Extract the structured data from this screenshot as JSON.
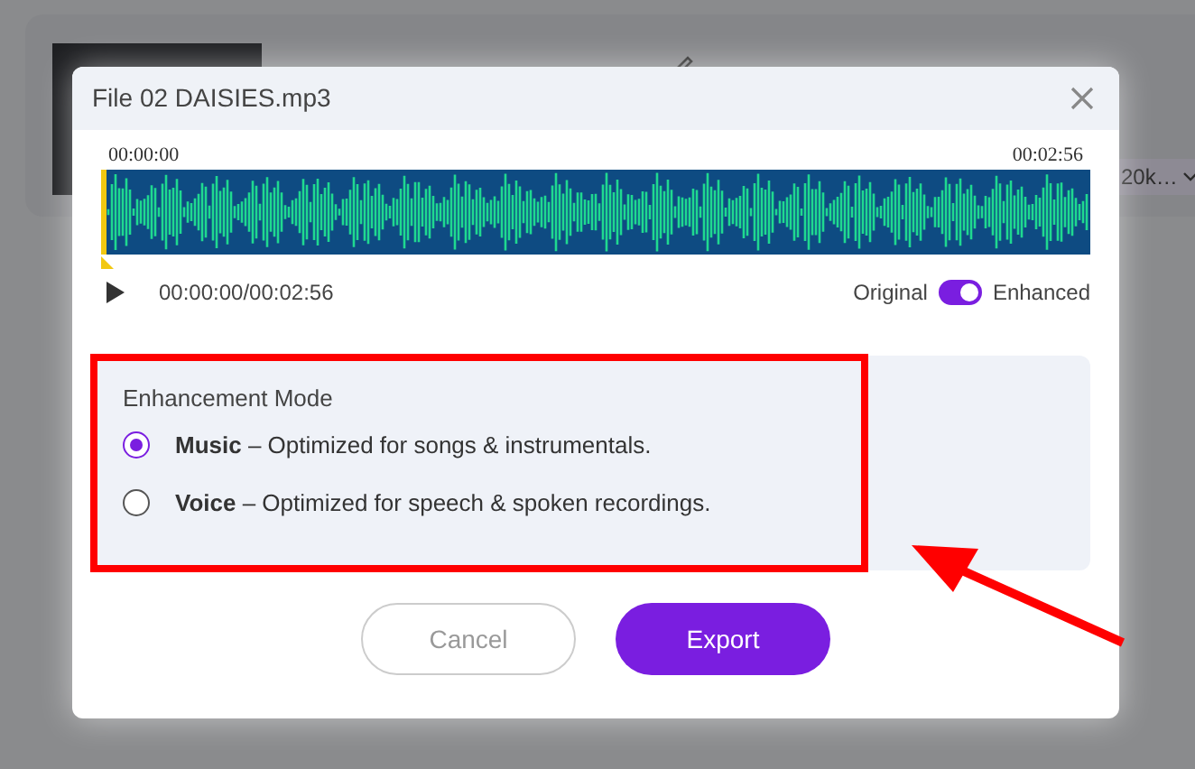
{
  "background": {
    "bitrate": "20k…"
  },
  "dialog": {
    "title": "File 02 DAISIES.mp3",
    "waveform": {
      "start_time": "00:00:00",
      "end_time": "00:02:56",
      "level": 0
    },
    "player": {
      "time": "00:00:00/00:02:56"
    },
    "toggle": {
      "off_label": "Original",
      "on_label": "Enhanced",
      "on": true
    },
    "enhancement": {
      "title": "Enhancement Mode",
      "options": [
        {
          "name": "Music",
          "description": " – Optimized for songs & instrumentals.",
          "selected": true
        },
        {
          "name": "Voice",
          "description": " – Optimized for speech & spoken recordings.",
          "selected": false
        }
      ]
    },
    "buttons": [
      {
        "label": "Cancel",
        "kind": "secondary"
      },
      {
        "label": "Export",
        "kind": "primary"
      }
    ]
  },
  "annotations": {
    "highlight_box": true,
    "arrow": true
  }
}
